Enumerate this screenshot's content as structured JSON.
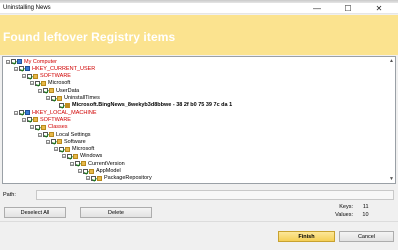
{
  "window": {
    "title": "Uninstalling News",
    "minimize_glyph": "—",
    "maximize_glyph": "☐",
    "close_glyph": "✕"
  },
  "banner": {
    "heading": "Found leftover Registry items"
  },
  "tree": [
    {
      "label": "My Computer",
      "depth": 0,
      "color": "red",
      "icon": "computer-icon",
      "expander": "−"
    },
    {
      "label": "HKEY_CURRENT_USER",
      "depth": 1,
      "color": "red",
      "icon": "registry-hive-icon",
      "expander": "−"
    },
    {
      "label": "SOFTWARE",
      "depth": 2,
      "color": "red",
      "icon": "folder-icon",
      "expander": "−"
    },
    {
      "label": "Microsoft",
      "depth": 3,
      "color": "black",
      "icon": "folder-icon",
      "expander": "−"
    },
    {
      "label": "UserData",
      "depth": 4,
      "color": "black",
      "icon": "folder-icon",
      "expander": "−"
    },
    {
      "label": "UninstallTimes",
      "depth": 5,
      "color": "black",
      "icon": "folder-icon",
      "expander": "−"
    },
    {
      "label": "Microsoft.BingNews_8wekyb3d8bbwe - 38 2f b0 75 39 7c da 1",
      "depth": 6,
      "color": "black",
      "icon": "registry-key-icon",
      "bold": true,
      "expander": ""
    },
    {
      "label": "HKEY_LOCAL_MACHINE",
      "depth": 1,
      "color": "red",
      "icon": "registry-hive-icon",
      "expander": "−"
    },
    {
      "label": "SOFTWARE",
      "depth": 2,
      "color": "red",
      "icon": "folder-icon",
      "expander": "−"
    },
    {
      "label": "Classes",
      "depth": 3,
      "color": "red",
      "icon": "folder-icon",
      "expander": "−"
    },
    {
      "label": "Local Settings",
      "depth": 4,
      "color": "black",
      "icon": "folder-icon",
      "expander": "−"
    },
    {
      "label": "Software",
      "depth": 5,
      "color": "black",
      "icon": "folder-icon",
      "expander": "−"
    },
    {
      "label": "Microsoft",
      "depth": 6,
      "color": "black",
      "icon": "folder-icon",
      "expander": "−"
    },
    {
      "label": "Windows",
      "depth": 7,
      "color": "black",
      "icon": "folder-icon",
      "expander": "−"
    },
    {
      "label": "CurrentVersion",
      "depth": 8,
      "color": "black",
      "icon": "folder-icon",
      "expander": "−"
    },
    {
      "label": "AppModel",
      "depth": 9,
      "color": "black",
      "icon": "folder-icon",
      "expander": "−"
    },
    {
      "label": "PackageRepository",
      "depth": 10,
      "color": "black",
      "icon": "folder-icon",
      "expander": "−"
    }
  ],
  "path": {
    "label": "Path:",
    "value": ""
  },
  "buttons": {
    "deselect_all": "Deselect All",
    "delete": "Delete",
    "finish": "Finish",
    "cancel": "Cancel"
  },
  "stats": {
    "keys_label": "Keys:",
    "keys_value": "11",
    "values_label": "Values:",
    "values_value": "10"
  },
  "colors": {
    "banner_bg": "#fbe38f",
    "banner_text": "#ffffff",
    "red_node": "#d00000",
    "finish_button": "#f5cf55"
  }
}
